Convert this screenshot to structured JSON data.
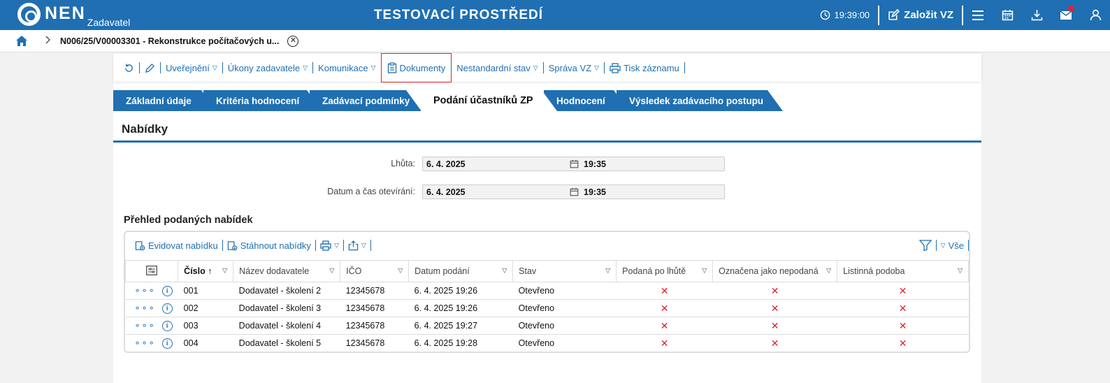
{
  "header": {
    "logo_text": "NEN",
    "logo_sub": "Zadavatel",
    "title": "TESTOVACÍ PROSTŘEDÍ",
    "time": "19:39:00",
    "create_label": "Založit VZ"
  },
  "breadcrumb": {
    "text": "N006/25/V00003301 - Rekonstrukce počítačových u..."
  },
  "toolbar": {
    "items": [
      "Uveřejnění",
      "Úkony zadavatele",
      "Komunikace",
      "Dokumenty",
      "Nestandardní stav",
      "Správa VZ",
      "Tisk záznamu"
    ]
  },
  "tabs": [
    "Základní údaje",
    "Kritéria hodnocení",
    "Zadávací podmínky",
    "Podání účastníků ZP",
    "Hodnocení",
    "Výsledek zadávacího postupu"
  ],
  "section": {
    "title": "Nabídky",
    "deadline_label": "Lhůta:",
    "deadline_date": "6. 4. 2025",
    "deadline_time": "19:35",
    "opening_label": "Datum a čas otevírání:",
    "opening_date": "6. 4. 2025",
    "opening_time": "19:35"
  },
  "grid": {
    "title": "Přehled podaných nabídek",
    "evidovat": "Evidovat nabídku",
    "stahnout": "Stáhnout nabídky",
    "filter_all": "Vše",
    "columns": [
      "Číslo",
      "Název dodavatele",
      "IČO",
      "Datum podání",
      "Stav",
      "Podaná po lhůtě",
      "Označena jako nepodaná",
      "Listinná podoba"
    ],
    "rows": [
      {
        "cislo": "001",
        "nazev": "Dodavatel - školení 2",
        "ico": "12345678",
        "datum": "6. 4. 2025 19:26",
        "stav": "Otevřeno"
      },
      {
        "cislo": "002",
        "nazev": "Dodavatel - školení 3",
        "ico": "12345678",
        "datum": "6. 4. 2025 19:26",
        "stav": "Otevřeno"
      },
      {
        "cislo": "003",
        "nazev": "Dodavatel - školení 4",
        "ico": "12345678",
        "datum": "6. 4. 2025 19:27",
        "stav": "Otevřeno"
      },
      {
        "cislo": "004",
        "nazev": "Dodavatel - školení 5",
        "ico": "12345678",
        "datum": "6. 4. 2025 19:28",
        "stav": "Otevřeno"
      }
    ],
    "mark_x": "✕"
  },
  "colors": {
    "brand": "#1f6fb2",
    "highlight": "#d9262c",
    "notification": "#e2203a"
  }
}
